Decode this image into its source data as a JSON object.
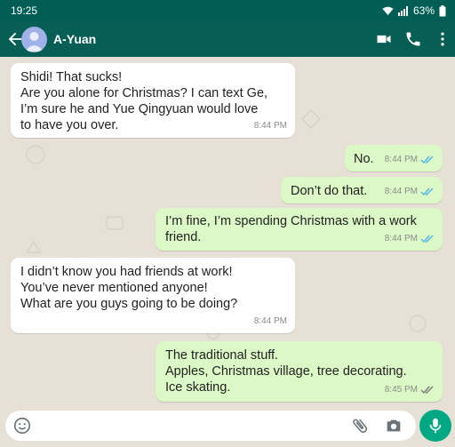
{
  "status_bar": {
    "time": "19:25",
    "battery": "63%"
  },
  "contact": {
    "name": "A-Yuan"
  },
  "messages": [
    {
      "direction": "in",
      "text": "Shidi! That sucks!\nAre you alone for Christmas? I can text Ge,\nI’m sure he and Yue Qingyuan would love\nto have you over.",
      "time": "8:44 PM"
    },
    {
      "direction": "out",
      "text": "No.",
      "time": "8:44 PM",
      "status": "read"
    },
    {
      "direction": "out",
      "text": "Don’t do that.",
      "time": "8:44 PM",
      "status": "read"
    },
    {
      "direction": "out",
      "text": "I’m fine, I’m spending Christmas with a work\nfriend.",
      "time": "8:44 PM",
      "status": "read"
    },
    {
      "direction": "in",
      "text": "I didn’t know you had friends at work!\nYou’ve never mentioned anyone!\nWhat are you guys going to be doing?",
      "time": "8:44 PM"
    },
    {
      "direction": "out",
      "text": "The traditional stuff.\nApples, Christmas village, tree decorating.\nIce skating.",
      "time": "8:45 PM",
      "status": "delivered"
    }
  ],
  "composer": {
    "placeholder": ""
  },
  "colors": {
    "header": "#075e54",
    "outgoing_bubble": "#dcf8c6",
    "read_tick": "#4fb6ec",
    "mic_button": "#00a884"
  },
  "icons": [
    "back-arrow-icon",
    "avatar-icon",
    "video-call-icon",
    "phone-icon",
    "more-icon",
    "emoji-icon",
    "attach-icon",
    "camera-icon",
    "mic-icon",
    "wifi-icon",
    "signal-icon",
    "battery-icon"
  ]
}
